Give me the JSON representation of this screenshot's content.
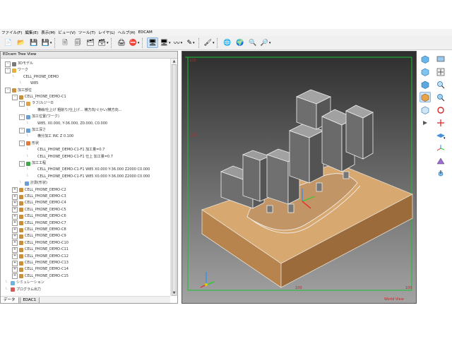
{
  "menu": [
    "ファイル(F)",
    "編集(E)",
    "表示(M)",
    "ビュー(V)",
    "ツール(T)",
    "レイヤ(L)",
    "ヘルプ(H)",
    "EDCAM"
  ],
  "tree": {
    "title": "EDcam Tree View",
    "rows": [
      {
        "text": "3Dモデル",
        "indent": 0,
        "toggle": "-",
        "icon": "model"
      },
      {
        "text": "ワーク",
        "indent": 0,
        "toggle": "-",
        "icon": "folder"
      },
      {
        "text": "CELL_PHONE_DEMO",
        "indent": 1,
        "toggle": "",
        "icon": "line"
      },
      {
        "text": "W85",
        "indent": 2,
        "toggle": "",
        "icon": "line"
      },
      {
        "text": "加工部位",
        "indent": 0,
        "toggle": "-",
        "icon": "gear"
      },
      {
        "text": "CELL_PHONE_DEMO-C1",
        "indent": 1,
        "toggle": "-",
        "icon": "gear"
      },
      {
        "text": "ラフ/ルジーO",
        "indent": 2,
        "toggle": "-",
        "icon": "tool"
      },
      {
        "text": "横線/仕上げ 粗削り/仕上げ...  横方向/ぐかい/横方向...",
        "indent": 3,
        "toggle": "",
        "icon": "line"
      },
      {
        "text": "加工位置(ワーク)",
        "indent": 2,
        "toggle": "-",
        "icon": "pos"
      },
      {
        "text": "W85, X0.000, Y-36.000, Z0.000, C0.000",
        "indent": 3,
        "toggle": "",
        "icon": "line"
      },
      {
        "text": "加工深さ",
        "indent": 2,
        "toggle": "-",
        "icon": "pos"
      },
      {
        "text": "横分加工 INC Z 0.100",
        "indent": 3,
        "toggle": "",
        "icon": "line"
      },
      {
        "text": "形状",
        "indent": 2,
        "toggle": "-",
        "icon": "shape"
      },
      {
        "text": "CELL_PHONE_DEMO-C1-F1 加工量=0.7",
        "indent": 3,
        "toggle": "",
        "icon": "line"
      },
      {
        "text": "CELL_PHONE_DEMO-C1-F1 仕上 加工量=0.7",
        "indent": 3,
        "toggle": "",
        "icon": "line"
      },
      {
        "text": "加工工程",
        "indent": 2,
        "toggle": "-",
        "icon": "proc"
      },
      {
        "text": "CELL_PHONE_DEMO-C1-F1 W85 X0.000 Y-36.000 Z2000 C0.000",
        "indent": 3,
        "toggle": "",
        "icon": "line"
      },
      {
        "text": "CELL_PHONE_DEMO-C1-F1 W85 X0.000 Y-36.000 Z2000 C0.000",
        "indent": 3,
        "toggle": "",
        "icon": "line"
      },
      {
        "text": "計測(形状)",
        "indent": 2,
        "toggle": "",
        "icon": "measure"
      },
      {
        "text": "CELL_PHONE_DEMO-C2",
        "indent": 1,
        "toggle": "+",
        "icon": "gear"
      },
      {
        "text": "CELL_PHONE_DEMO-C3",
        "indent": 1,
        "toggle": "+",
        "icon": "gear"
      },
      {
        "text": "CELL_PHONE_DEMO-C4",
        "indent": 1,
        "toggle": "+",
        "icon": "gear"
      },
      {
        "text": "CELL_PHONE_DEMO-C5",
        "indent": 1,
        "toggle": "+",
        "icon": "gear"
      },
      {
        "text": "CELL_PHONE_DEMO-C6",
        "indent": 1,
        "toggle": "+",
        "icon": "gear"
      },
      {
        "text": "CELL_PHONE_DEMO-C7",
        "indent": 1,
        "toggle": "+",
        "icon": "gear"
      },
      {
        "text": "CELL_PHONE_DEMO-C8",
        "indent": 1,
        "toggle": "+",
        "icon": "gear"
      },
      {
        "text": "CELL_PHONE_DEMO-C9",
        "indent": 1,
        "toggle": "+",
        "icon": "gear"
      },
      {
        "text": "CELL_PHONE_DEMO-C10",
        "indent": 1,
        "toggle": "+",
        "icon": "gear"
      },
      {
        "text": "CELL_PHONE_DEMO-C11",
        "indent": 1,
        "toggle": "+",
        "icon": "gear"
      },
      {
        "text": "CELL_PHONE_DEMO-C12",
        "indent": 1,
        "toggle": "+",
        "icon": "gear"
      },
      {
        "text": "CELL_PHONE_DEMO-C13",
        "indent": 1,
        "toggle": "+",
        "icon": "gear"
      },
      {
        "text": "CELL_PHONE_DEMO-C14",
        "indent": 1,
        "toggle": "+",
        "icon": "gear"
      },
      {
        "text": "CELL_PHONE_DEMO-C15",
        "indent": 1,
        "toggle": "+",
        "icon": "gear"
      },
      {
        "text": "シミュレーション",
        "indent": 0,
        "toggle": "",
        "icon": "sim"
      },
      {
        "text": "プログラム出力",
        "indent": 0,
        "toggle": "",
        "icon": "prog"
      }
    ],
    "tabs": [
      "データ",
      "EDAC1"
    ]
  },
  "viewport": {
    "ruler_labels": [
      "100",
      "100",
      "100",
      "100"
    ],
    "corner_label": "World View"
  },
  "colors": {
    "viewport_top": "#2f2f2f",
    "viewport_bottom": "#9d9d9d",
    "ruler_green": "#17c234",
    "block_wood": "#c5925c",
    "parts_gray": "#707070"
  },
  "toolbar_icons": [
    "new-file-icon",
    "open-folder-icon",
    "save-icon",
    "save-as-icon",
    "print-icon",
    "copy-icon",
    "paste-icon",
    "layers-icon",
    "stack-icon",
    "monitor-icon",
    "screen-icon",
    "spline-icon",
    "pen-icon",
    "brush-icon",
    "globe-icon",
    "globe2-icon",
    "search-icon",
    "zoom-icon"
  ],
  "right_icons": [
    "iso-view-icon",
    "front-view-icon",
    "side-view-icon",
    "top-view-icon",
    "shade-view-icon",
    "zoom-fit-icon",
    "zoom-in-icon",
    "rotate-icon",
    "move-icon",
    "light-icon",
    "axis-icon",
    "grid-icon"
  ]
}
